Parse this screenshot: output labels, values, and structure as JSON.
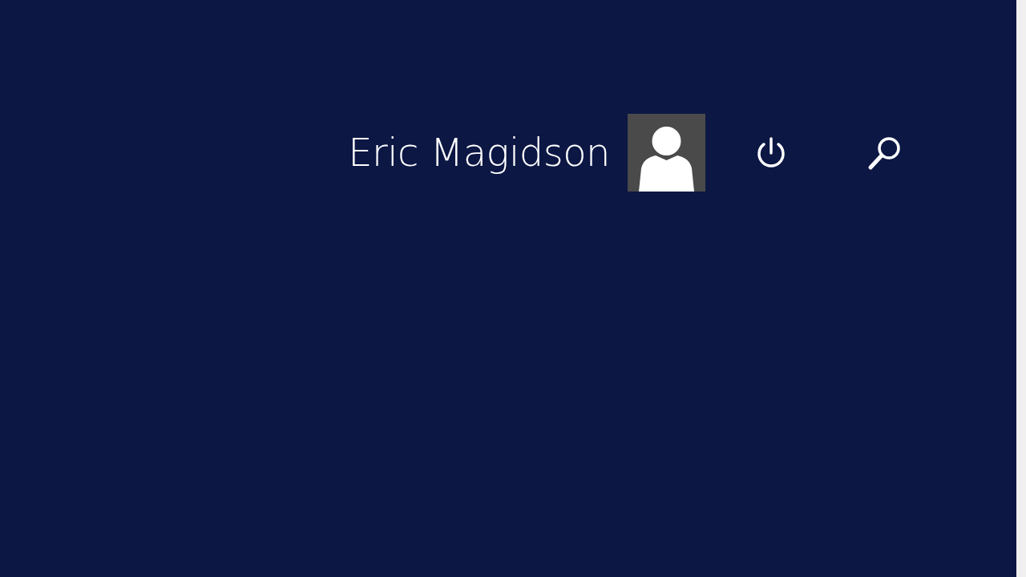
{
  "user": {
    "name": "Eric Magidson"
  }
}
